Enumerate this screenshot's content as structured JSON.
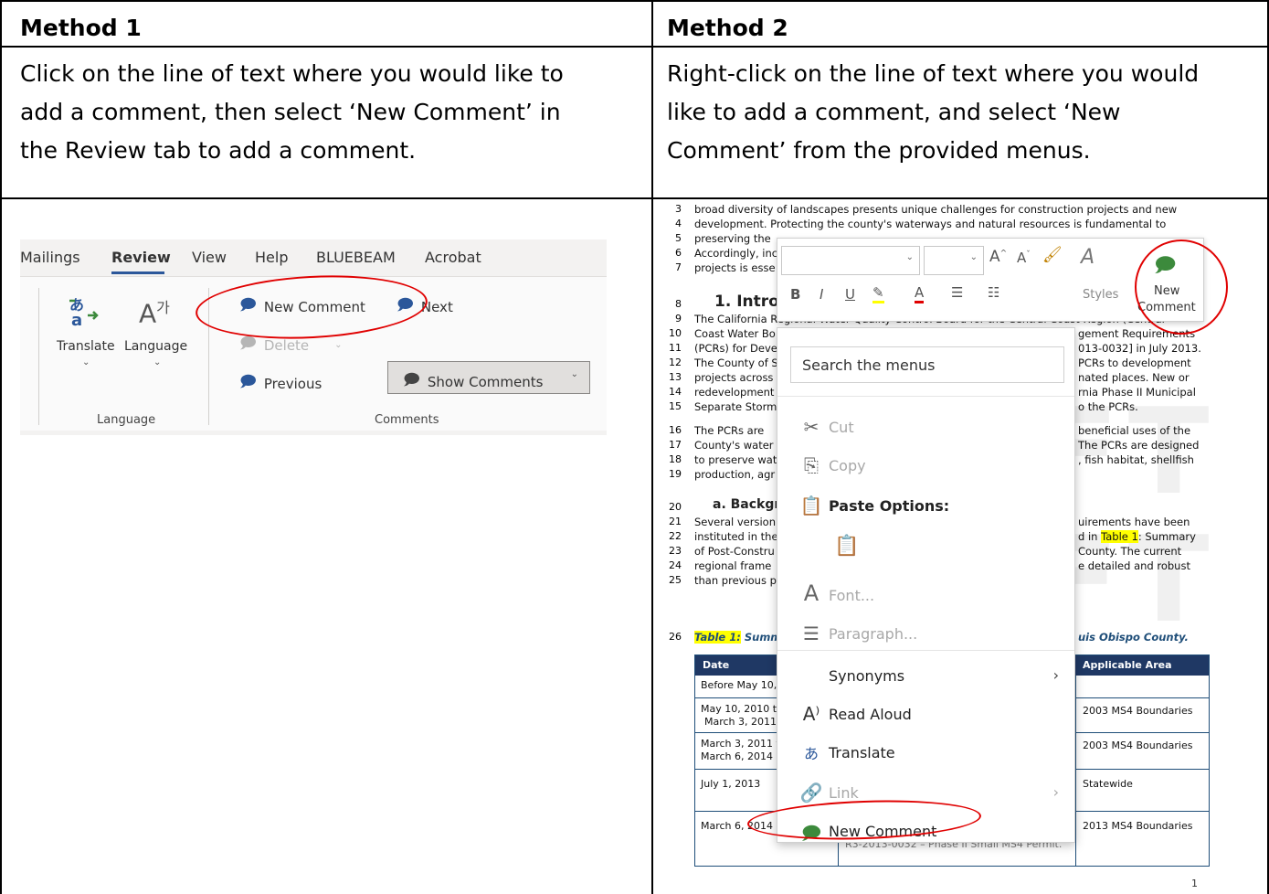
{
  "table": {
    "method1": {
      "header": "Method 1",
      "description_lines": [
        "Click on the line of text where you would like to",
        "add a comment, then select ‘New Comment’ in",
        "the Review tab to add a comment."
      ]
    },
    "method2": {
      "header": "Method 2",
      "description_lines": [
        "Right-click on the line of text where you would",
        "like to add a comment, and select ‘New",
        "Comment’ from the provided menus."
      ]
    }
  },
  "ribbon": {
    "tabs": [
      "Mailings",
      "Review",
      "View",
      "Help",
      "BLUEBEAM",
      "Acrobat"
    ],
    "translate_label": "Translate",
    "language_label": "Language",
    "new_comment": "New Comment",
    "next": "Next",
    "delete": "Delete",
    "show_comments": "Show Comments",
    "previous": "Previous",
    "group_language": "Language",
    "group_comments": "Comments"
  },
  "doc": {
    "line_numbers": [
      "3",
      "4",
      "5",
      "6",
      "7",
      "8",
      "9",
      "10",
      "11",
      "12",
      "13",
      "14",
      "15",
      "16",
      "17",
      "18",
      "19",
      "20",
      "21",
      "22",
      "23",
      "24",
      "25",
      "26"
    ],
    "lines": [
      "broad diversity of landscapes presents unique challenges for construction projects and new",
      "development. Protecting the county's waterways and natural resources is fundamental to",
      "preserving the",
      "Accordingly, inc",
      "projects is esse"
    ],
    "heading1": "1. Intro",
    "para1": [
      "The California Regional Water Quality Control Board for the Central Coast Region (Central",
      "Coast Water Bo",
      "(PCRs) for Deve",
      "The County of S",
      "projects across",
      "redevelopment",
      "Separate Storm"
    ],
    "para1_right": [
      "gement Requirements",
      "013-0032] in July 2013.",
      "PCRs to development",
      "nated places. New or",
      "rnia Phase II Municipal",
      "o the PCRs."
    ],
    "para2": [
      "The PCRs are",
      "County's water",
      "to preserve wat",
      "production, agr"
    ],
    "para2_right": [
      "beneficial uses of the",
      "The PCRs are designed",
      ", fish habitat, shellfish"
    ],
    "heading2": "a. Backgr",
    "para3": [
      "Several version",
      "instituted in the",
      "of Post-Constru",
      "regional frame",
      "than previous p"
    ],
    "para3_right": [
      "uirements have been",
      "d in",
      "Table 1",
      ": Summary",
      "County. The current",
      "e detailed and robust"
    ],
    "caption_left": "Table 1:",
    "caption_left2": "Summar",
    "caption_right": "uis Obispo County.",
    "table_headers": [
      "Date",
      "Applicable Area"
    ],
    "table_dates": [
      "Before May 10,",
      "May 10, 2010 th",
      "March 3, 2011",
      "March 3, 2011 t",
      "March 6, 2014",
      "July 1, 2013",
      "March 6, 2014"
    ],
    "table_areas": [
      "2003 MS4 Boundaries",
      "2003 MS4 Boundaries",
      "Statewide",
      "2013 MS4 Boundaries"
    ],
    "table_footer": "R3-2013-0032 – Phase II Small MS4 Permit.",
    "page_number": "1"
  },
  "mini_toolbar": {
    "styles_label": "Styles",
    "new_comment_line1": "New",
    "new_comment_line2": "Comment"
  },
  "context_menu": {
    "search_placeholder": "Search the menus",
    "cut": "Cut",
    "copy": "Copy",
    "paste_options": "Paste Options:",
    "font": "Font...",
    "paragraph": "Paragraph...",
    "synonyms": "Synonyms",
    "read_aloud": "Read Aloud",
    "translate": "Translate",
    "link": "Link",
    "new_comment": "New Comment"
  },
  "colors": {
    "annotation_red": "#e00000",
    "accent_blue": "#2b579a",
    "table_header_navy": "#1f3864",
    "highlight_yellow": "#ffff00"
  }
}
